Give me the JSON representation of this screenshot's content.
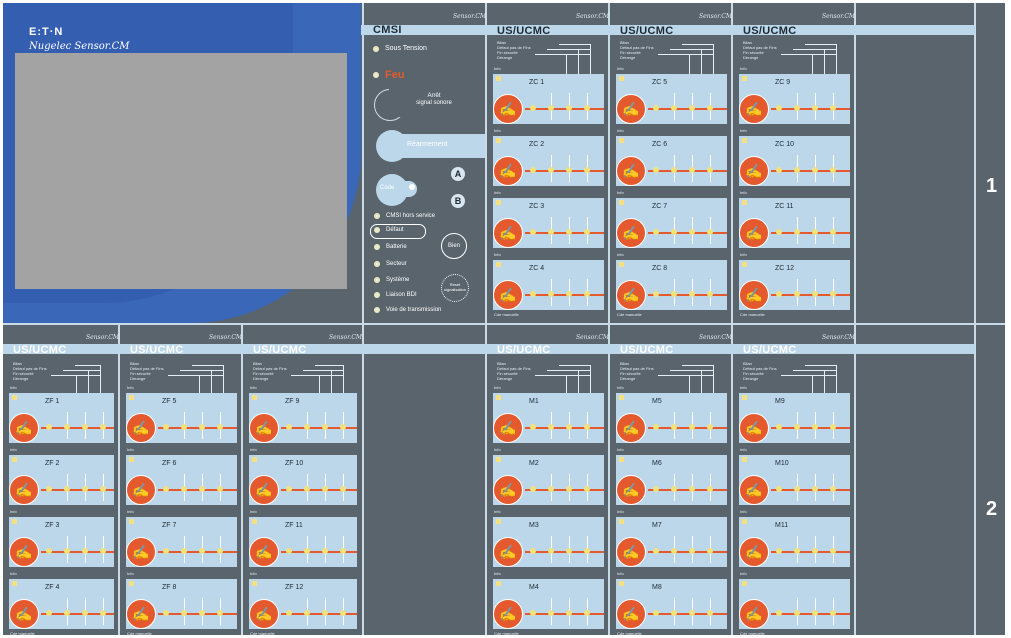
{
  "colors": {
    "panel": "#59646c",
    "band": "#bcd7ea",
    "accent": "#e45a2e",
    "indicator": "#f2e27a",
    "screen": "#a3a3a3",
    "logo_bg": "#3a67b8"
  },
  "brand_small": "Sensor.CM",
  "logo": {
    "brand": "E:T·N",
    "product": "Nugelec Sensor.CM"
  },
  "cmsi": {
    "title": "CMSI",
    "sous_tension": "Sous Tension",
    "feu": "Feu",
    "arret": [
      "Arrêt",
      "signal sonore"
    ],
    "rearmement": "Réarmement",
    "code": "Code",
    "a": "A",
    "b": "B",
    "status": [
      "CMSI hors service",
      "Défaut",
      "Batterie",
      "Secteur",
      "Système",
      "Liaison BDI",
      "Voie de transmission"
    ],
    "bien": "Bien",
    "reset": [
      "Reset",
      "signalisation"
    ]
  },
  "legend_lines": [
    "Bilan",
    "Défaut pas de Fins",
    "Fin sécurité",
    "Dérange"
  ],
  "zone_tag": "Info",
  "foot_label": "Cde manuelle",
  "modules": [
    {
      "title": "US/UCMC",
      "zones": [
        "ZC 1",
        "ZC 2",
        "ZC 3",
        "ZC 4"
      ]
    },
    {
      "title": "US/UCMC",
      "zones": [
        "ZC 5",
        "ZC 6",
        "ZC 7",
        "ZC 8"
      ]
    },
    {
      "title": "US/UCMC",
      "zones": [
        "ZC 9",
        "ZC 10",
        "ZC 11",
        "ZC 12"
      ]
    },
    {
      "title": "US/UCMC",
      "zones": [
        "ZF 1",
        "ZF 2",
        "ZF 3",
        "ZF 4"
      ]
    },
    {
      "title": "US/UCMC",
      "zones": [
        "ZF 5",
        "ZF 6",
        "ZF 7",
        "ZF 8"
      ]
    },
    {
      "title": "US/UCMC",
      "zones": [
        "ZF 9",
        "ZF 10",
        "ZF 11",
        "ZF 12"
      ]
    },
    {
      "title": "US/UCMC",
      "zones": [
        "M1",
        "M2",
        "M3",
        "M4"
      ]
    },
    {
      "title": "US/UCMC",
      "zones": [
        "M5",
        "M6",
        "M7",
        "M8"
      ]
    },
    {
      "title": "US/UCMC",
      "zones": [
        "M9",
        "M10",
        "M11",
        ""
      ]
    }
  ],
  "row_numbers": [
    "1",
    "2"
  ]
}
